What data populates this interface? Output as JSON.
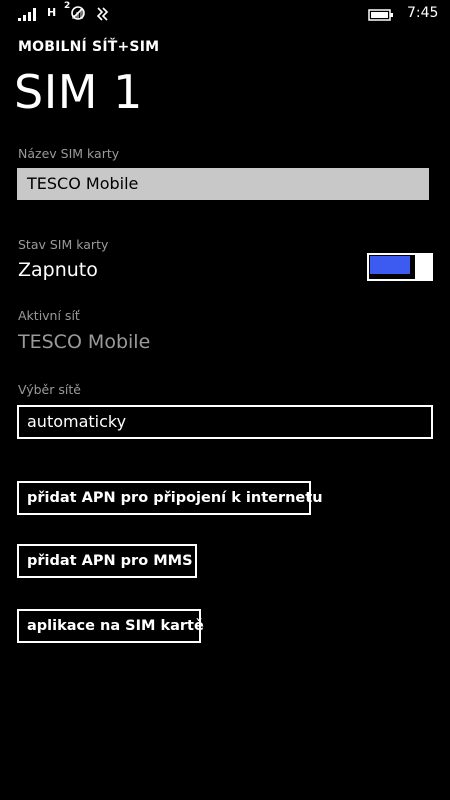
{
  "status_bar": {
    "network_type": "H",
    "sim2_label": "2",
    "time": "7:45",
    "icons": {
      "signal": "signal-strength-icon",
      "sim2": "sim2-no-signal-icon",
      "vibrate": "vibrate-icon",
      "battery": "battery-icon"
    }
  },
  "header": {
    "app_title": "MOBILNÍ SÍŤ+SIM",
    "page_title": "SIM 1"
  },
  "sim_name": {
    "label": "Název SIM karty",
    "value": "TESCO Mobile"
  },
  "sim_state": {
    "label": "Stav SIM karty",
    "value": "Zapnuto",
    "toggle_on": true
  },
  "active_network": {
    "label": "Aktivní síť",
    "value": "TESCO Mobile"
  },
  "network_selection": {
    "label": "Výběr sítě",
    "value": "automaticky"
  },
  "buttons": {
    "add_apn_internet": "přidat APN pro připojení k internetu",
    "add_apn_mms": "přidat APN pro MMS",
    "sim_apps": "aplikace na SIM kartě"
  },
  "colors": {
    "accent": "#3d5af1",
    "background": "#000000",
    "label_gray": "#9a9a9a",
    "textbox_bg": "#c8c8c8"
  }
}
